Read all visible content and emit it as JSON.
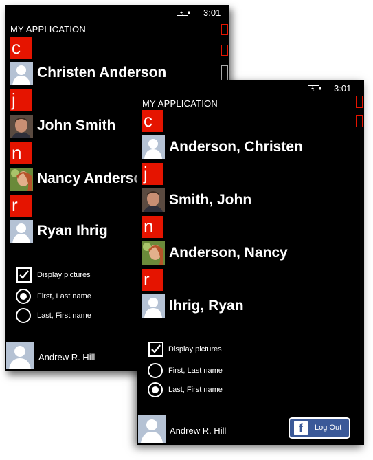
{
  "status_bar": {
    "time": "3:01"
  },
  "app_title": "MY APPLICATION",
  "back_screen": {
    "groups": [
      {
        "letter": "c",
        "name": "Christen Anderson",
        "avatar": "placeholder"
      },
      {
        "letter": "j",
        "name": "John Smith",
        "avatar": "photo-man"
      },
      {
        "letter": "n",
        "name": "Nancy Anderson",
        "avatar": "photo-woman"
      },
      {
        "letter": "r",
        "name": "Ryan Ihrig",
        "avatar": "placeholder"
      }
    ],
    "options": {
      "display_pictures": {
        "label": "Display pictures",
        "checked": true
      },
      "first_last": {
        "label": "First, Last name",
        "selected": true
      },
      "last_first": {
        "label": "Last, First name",
        "selected": false
      }
    },
    "user_name": "Andrew R. Hill"
  },
  "front_screen": {
    "groups": [
      {
        "letter": "c",
        "name": "Anderson, Christen",
        "avatar": "placeholder"
      },
      {
        "letter": "j",
        "name": "Smith, John",
        "avatar": "photo-man"
      },
      {
        "letter": "n",
        "name": "Anderson, Nancy",
        "avatar": "photo-woman"
      },
      {
        "letter": "r",
        "name": "Ihrig, Ryan",
        "avatar": "placeholder"
      }
    ],
    "options": {
      "display_pictures": {
        "label": "Display pictures",
        "checked": true
      },
      "first_last": {
        "label": "First, Last name",
        "selected": false
      },
      "last_first": {
        "label": "Last, First name",
        "selected": true
      }
    },
    "user_name": "Andrew R. Hill",
    "logout_button": {
      "logo": "f",
      "label": "Log Out"
    }
  },
  "colors": {
    "accent": "#e51400",
    "background": "#000000",
    "facebook": "#3b5998",
    "placeholder": "#b5c2d4"
  }
}
